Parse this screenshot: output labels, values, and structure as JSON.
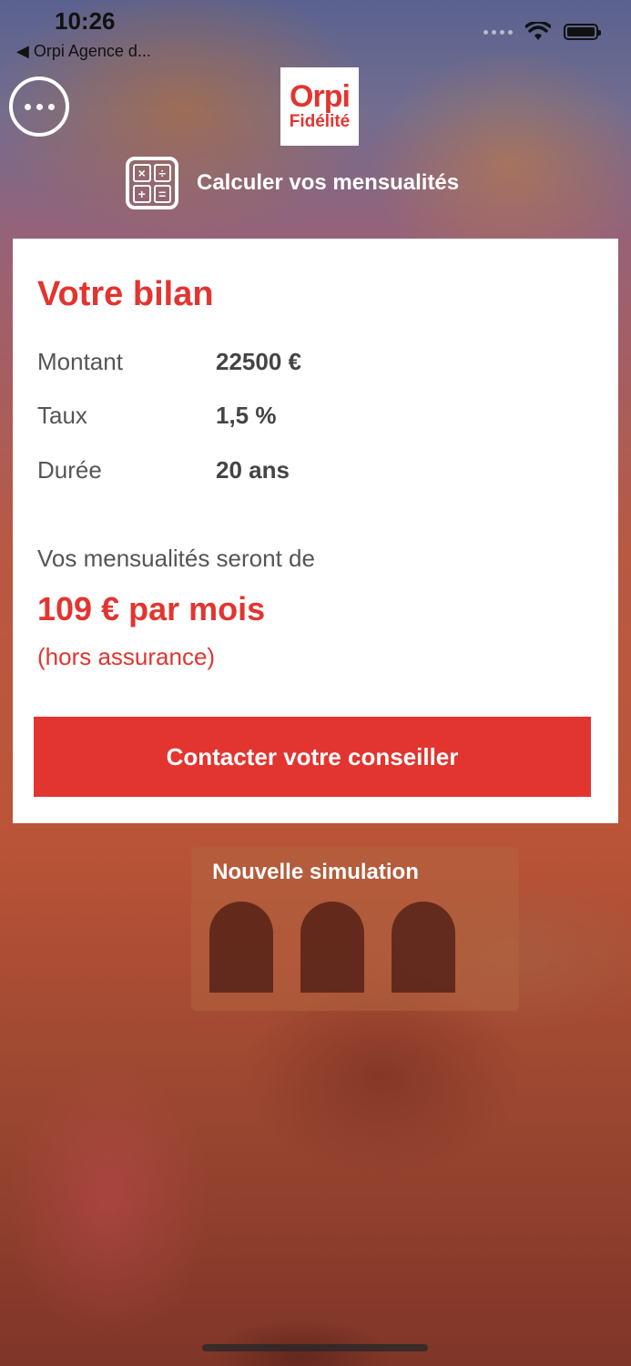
{
  "status_bar": {
    "time": "10:26",
    "back_label": "◀ Orpi Agence d..."
  },
  "header": {
    "logo_main": "Orpi",
    "logo_sub": "Fidélité",
    "calc_title": "Calculer vos mensualités",
    "calc_symbols": [
      "×",
      "÷",
      "+",
      "="
    ]
  },
  "card": {
    "title": "Votre bilan",
    "rows": [
      {
        "label": "Montant",
        "value": "22500 €"
      },
      {
        "label": "Taux",
        "value": "1,5 %"
      },
      {
        "label": "Durée",
        "value": "20 ans"
      }
    ],
    "mens_label": "Vos mensualités seront de",
    "mens_value": "109 € par mois",
    "mens_note": "(hors assurance)",
    "contact_button": "Contacter votre conseiller"
  },
  "new_simulation": "Nouvelle simulation",
  "colors": {
    "accent": "#e23530",
    "card_bg": "#ffffff"
  },
  "icons": {
    "menu": "more-dots-icon",
    "calculator": "calculator-icon",
    "wifi": "wifi-icon",
    "battery": "battery-icon",
    "signal": "signal-icon"
  }
}
